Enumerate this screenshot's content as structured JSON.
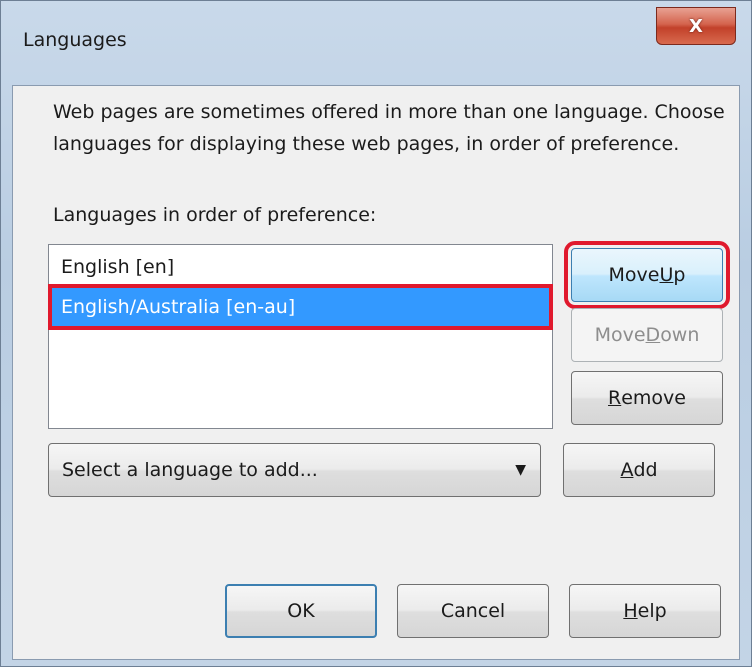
{
  "window": {
    "title": "Languages",
    "close_label": "X"
  },
  "description": "Web pages are sometimes offered in more than one language. Choose languages for displaying these web pages, in order of preference.",
  "list_label": "Languages in order of preference:",
  "languages": [
    {
      "label": "English  [en]",
      "selected": false
    },
    {
      "label": "English/Australia  [en-au]",
      "selected": true
    }
  ],
  "buttons": {
    "move_up": {
      "pre": "Move ",
      "accel": "U",
      "post": "p"
    },
    "move_down": {
      "pre": "Move ",
      "accel": "D",
      "post": "own"
    },
    "remove": {
      "pre": "",
      "accel": "R",
      "post": "emove"
    },
    "add": {
      "pre": "",
      "accel": "A",
      "post": "dd"
    },
    "ok": "OK",
    "cancel": "Cancel",
    "help": {
      "pre": "",
      "accel": "H",
      "post": "elp"
    }
  },
  "language_select": {
    "value": "Select a language to add...",
    "arrow_icon": "dropdown-arrow-icon"
  }
}
